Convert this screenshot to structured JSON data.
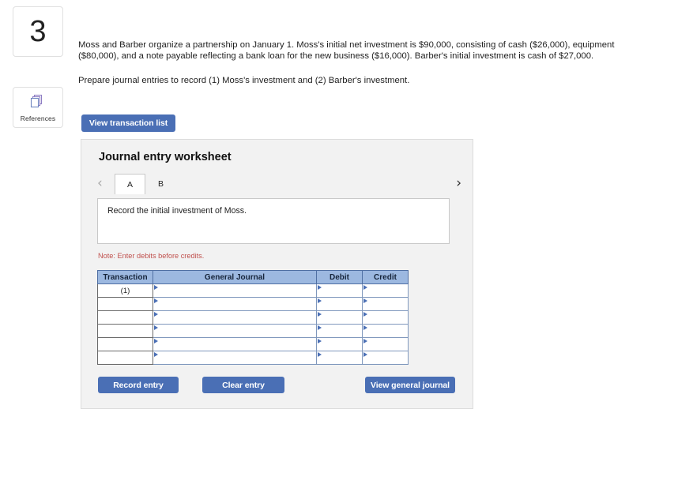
{
  "question": {
    "number": "3",
    "references_label": "References",
    "paragraph_1": "Moss and Barber organize a partnership on January 1. Moss's initial net investment is $90,000, consisting of cash ($26,000), equipment ($80,000), and a note payable reflecting a bank loan for the new business ($16,000). Barber's initial investment is cash of $27,000.",
    "paragraph_2": "Prepare journal entries to record (1) Moss's investment and (2) Barber's investment.",
    "view_transaction_list_label": "View transaction list"
  },
  "worksheet": {
    "title": "Journal entry worksheet",
    "prev_arrow": "‹",
    "next_arrow": "›",
    "tabs": [
      {
        "label": "A",
        "active": true
      },
      {
        "label": "B",
        "active": false
      }
    ],
    "instruction": "Record the initial investment of Moss.",
    "note": "Note: Enter debits before credits.",
    "table": {
      "headers": [
        "Transaction",
        "General Journal",
        "Debit",
        "Credit"
      ],
      "rows": [
        {
          "transaction": "(1)",
          "general_journal": "",
          "debit": "",
          "credit": ""
        },
        {
          "transaction": "",
          "general_journal": "",
          "debit": "",
          "credit": ""
        },
        {
          "transaction": "",
          "general_journal": "",
          "debit": "",
          "credit": ""
        },
        {
          "transaction": "",
          "general_journal": "",
          "debit": "",
          "credit": ""
        },
        {
          "transaction": "",
          "general_journal": "",
          "debit": "",
          "credit": ""
        },
        {
          "transaction": "",
          "general_journal": "",
          "debit": "",
          "credit": ""
        }
      ]
    },
    "buttons": {
      "record_entry": "Record entry",
      "clear_entry": "Clear entry",
      "view_general_journal": "View general journal"
    }
  },
  "colors": {
    "button_blue": "#4a6fb5",
    "table_header_blue": "#9cb8e0",
    "note_red": "#c0504d",
    "panel_gray": "#f2f2f2"
  }
}
